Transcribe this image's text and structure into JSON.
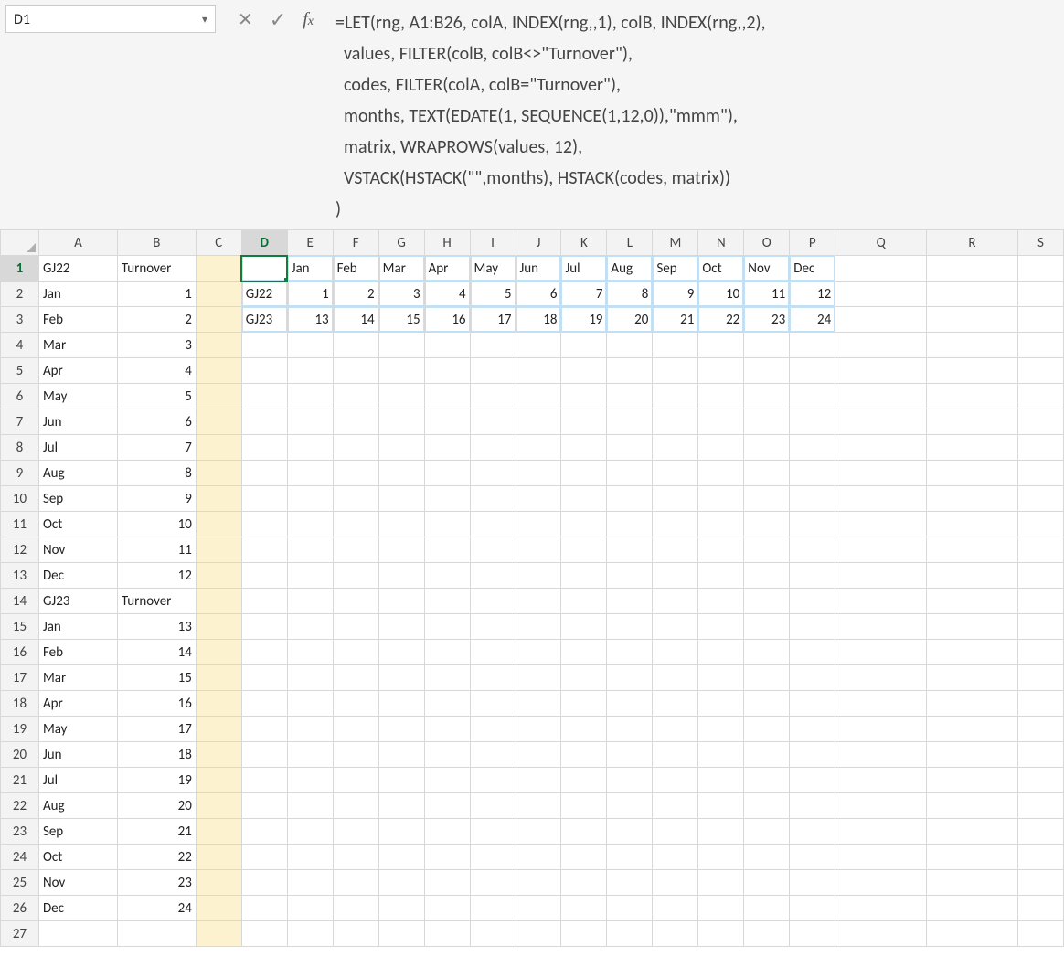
{
  "name_box": {
    "value": "D1"
  },
  "formula_bar": {
    "text": "=LET(rng, A1:B26, colA, INDEX(rng,,1), colB, INDEX(rng,,2),\n  values, FILTER(colB, colB<>\"Turnover\"),\n  codes, FILTER(colA, colB=\"Turnover\"),\n  months, TEXT(EDATE(1, SEQUENCE(1,12,0)),\"mmm\"),\n  matrix, WRAPROWS(values, 12),\n  VSTACK(HSTACK(\"\",months), HSTACK(codes, matrix))\n)"
  },
  "columns": [
    "A",
    "B",
    "C",
    "D",
    "E",
    "F",
    "G",
    "H",
    "I",
    "J",
    "K",
    "L",
    "M",
    "N",
    "O",
    "P",
    "Q",
    "R",
    "S"
  ],
  "row_count": 27,
  "source": {
    "rows": [
      {
        "a": "GJ22",
        "b": "Turnover"
      },
      {
        "a": "Jan",
        "b": "1"
      },
      {
        "a": "Feb",
        "b": "2"
      },
      {
        "a": "Mar",
        "b": "3"
      },
      {
        "a": "Apr",
        "b": "4"
      },
      {
        "a": "May",
        "b": "5"
      },
      {
        "a": "Jun",
        "b": "6"
      },
      {
        "a": "Jul",
        "b": "7"
      },
      {
        "a": "Aug",
        "b": "8"
      },
      {
        "a": "Sep",
        "b": "9"
      },
      {
        "a": "Oct",
        "b": "10"
      },
      {
        "a": "Nov",
        "b": "11"
      },
      {
        "a": "Dec",
        "b": "12"
      },
      {
        "a": "GJ23",
        "b": "Turnover"
      },
      {
        "a": "Jan",
        "b": "13"
      },
      {
        "a": "Feb",
        "b": "14"
      },
      {
        "a": "Mar",
        "b": "15"
      },
      {
        "a": "Apr",
        "b": "16"
      },
      {
        "a": "May",
        "b": "17"
      },
      {
        "a": "Jun",
        "b": "18"
      },
      {
        "a": "Jul",
        "b": "19"
      },
      {
        "a": "Aug",
        "b": "20"
      },
      {
        "a": "Sep",
        "b": "21"
      },
      {
        "a": "Oct",
        "b": "22"
      },
      {
        "a": "Nov",
        "b": "23"
      },
      {
        "a": "Dec",
        "b": "24"
      }
    ]
  },
  "output": {
    "header": [
      "",
      "Jan",
      "Feb",
      "Mar",
      "Apr",
      "May",
      "Jun",
      "Jul",
      "Aug",
      "Sep",
      "Oct",
      "Nov",
      "Dec"
    ],
    "rows": [
      {
        "code": "GJ22",
        "vals": [
          "1",
          "2",
          "3",
          "4",
          "5",
          "6",
          "7",
          "8",
          "9",
          "10",
          "11",
          "12"
        ]
      },
      {
        "code": "GJ23",
        "vals": [
          "13",
          "14",
          "15",
          "16",
          "17",
          "18",
          "19",
          "20",
          "21",
          "22",
          "23",
          "24"
        ]
      }
    ]
  },
  "selection": {
    "col": "D",
    "row": 1
  },
  "highlight_column": "C"
}
